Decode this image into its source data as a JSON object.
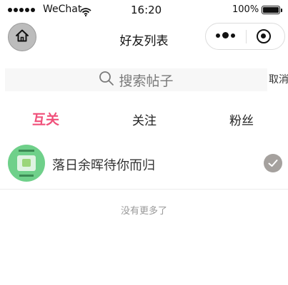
{
  "status_bar": {
    "carrier": "WeChat",
    "time": "16:20",
    "battery_percent": "100%",
    "icons": [
      "signal-dots-icon",
      "wifi-icon",
      "battery-icon"
    ]
  },
  "nav_bar": {
    "title": "好友列表",
    "icons": [
      "home-icon",
      "more-icon",
      "close-icon"
    ]
  },
  "search": {
    "placeholder": "搜索帖子",
    "cancel_label": "取消",
    "icon": "search-icon"
  },
  "tabs": [
    {
      "label": "互关",
      "active": true
    },
    {
      "label": "关注",
      "active": false
    },
    {
      "label": "粉丝",
      "active": false
    }
  ],
  "users": [
    {
      "name": "落日余晖待你而归",
      "followed": true
    }
  ],
  "footer": {
    "no_more_text": "没有更多了"
  },
  "colors": {
    "accent": "#f0507a",
    "avatar_bg": "#6fd08a",
    "check_bg": "#a5a19e",
    "search_bg": "#f7f7f7"
  }
}
